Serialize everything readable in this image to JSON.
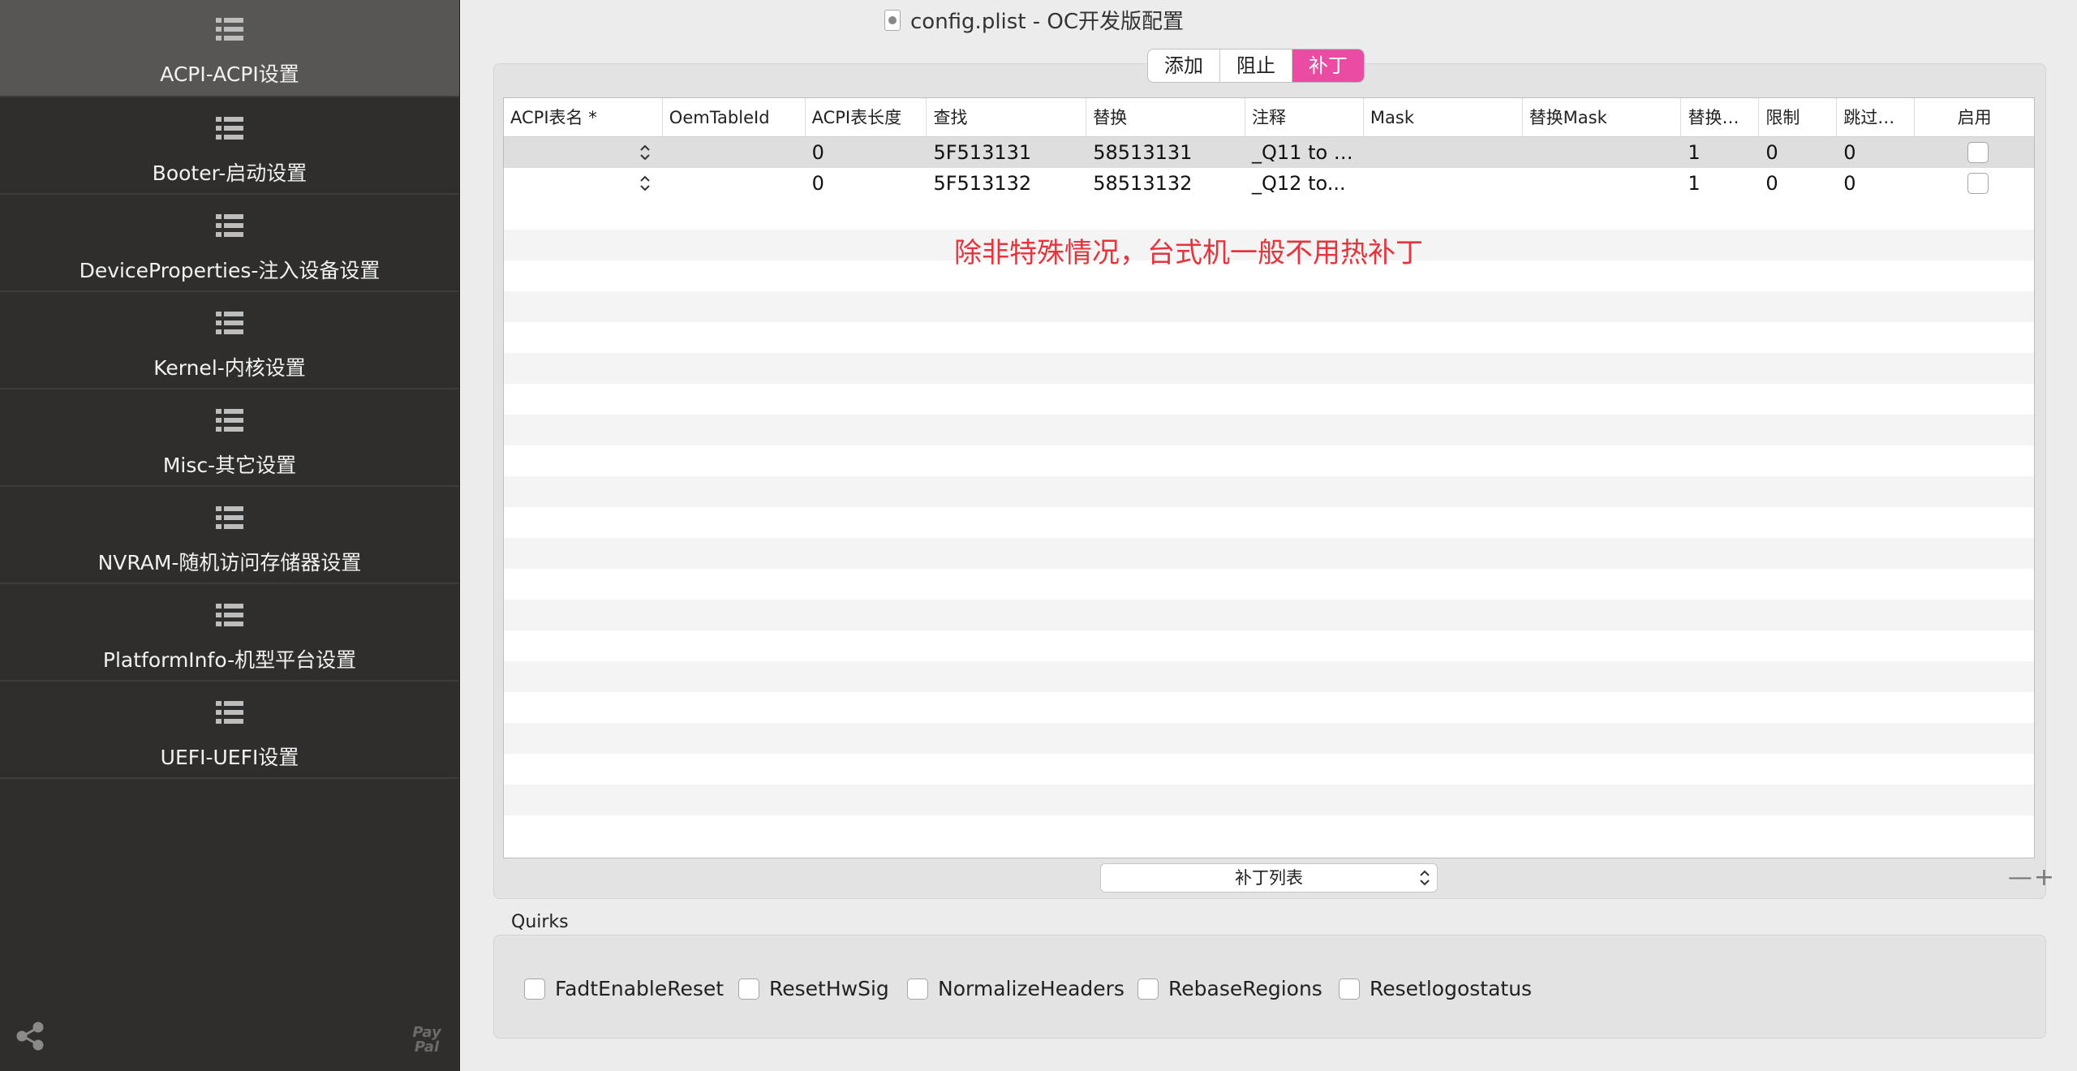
{
  "window": {
    "title": "config.plist - OC开发版配置"
  },
  "sidebar": {
    "items": [
      {
        "label": "ACPI-ACPI设置",
        "active": true
      },
      {
        "label": "Booter-启动设置"
      },
      {
        "label": "DeviceProperties-注入设备设置"
      },
      {
        "label": "Kernel-内核设置"
      },
      {
        "label": "Misc-其它设置"
      },
      {
        "label": "NVRAM-随机访问存储器设置"
      },
      {
        "label": "PlatformInfo-机型平台设置"
      },
      {
        "label": "UEFI-UEFI设置"
      }
    ],
    "paypal_text": "Pay Pal",
    "icons": {
      "list": "list-icon",
      "share": "share-icon",
      "paypal": "paypal-icon"
    }
  },
  "segments": [
    {
      "label": "添加"
    },
    {
      "label": "阻止"
    },
    {
      "label": "补丁",
      "active": true
    }
  ],
  "table": {
    "columns": [
      "ACPI表名 *",
      "OemTableId",
      "ACPI表长度",
      "查找",
      "替换",
      "注释",
      "Mask",
      "替换Mask",
      "替换…",
      "限制",
      "跳过…",
      "启用"
    ],
    "rows": [
      {
        "table_sig": "",
        "oem": "",
        "length": "0",
        "find": "5F513131",
        "replace": "58513131",
        "comment": "_Q11 to X...",
        "mask": "",
        "replace_mask": "",
        "count": "1",
        "limit": "0",
        "skip": "0",
        "enabled": false
      },
      {
        "table_sig": "",
        "oem": "",
        "length": "0",
        "find": "5F513132",
        "replace": "58513132",
        "comment": "_Q12 to...",
        "mask": "",
        "replace_mask": "",
        "count": "1",
        "limit": "0",
        "skip": "0",
        "enabled": false
      }
    ],
    "note": "除非特殊情况，台式机一般不用热补丁"
  },
  "bottom": {
    "popup_label": "补丁列表",
    "minus": "—",
    "plus": "+"
  },
  "quirks": {
    "label": "Quirks",
    "items": [
      {
        "label": "FadtEnableReset",
        "checked": false
      },
      {
        "label": "ResetHwSig",
        "checked": false
      },
      {
        "label": "NormalizeHeaders",
        "checked": false
      },
      {
        "label": "RebaseRegions",
        "checked": false
      },
      {
        "label": "Resetlogostatus",
        "checked": false
      }
    ]
  },
  "colors": {
    "accent": "#ea4ba3",
    "note": "#e6343d",
    "sidebar_bg": "#2f2e2c",
    "sidebar_active": "#575654"
  }
}
